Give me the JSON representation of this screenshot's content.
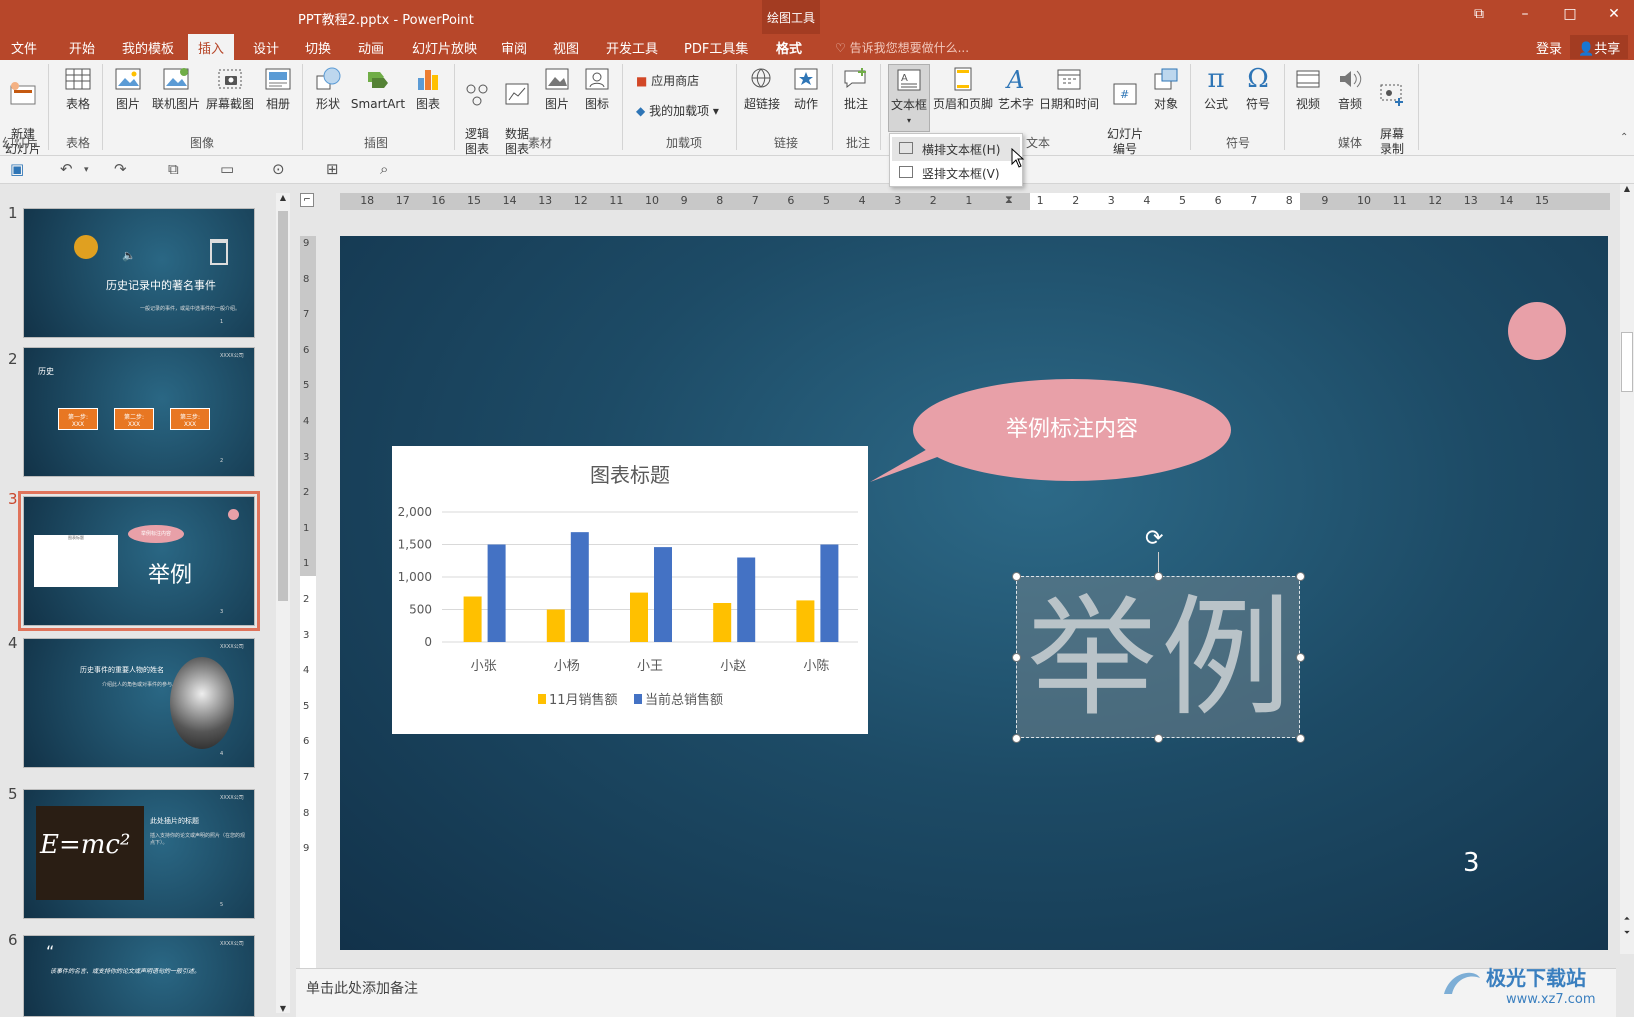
{
  "titlebar": {
    "document_title": "PPT教程2.pptx - PowerPoint",
    "context_tab": "绘图工具"
  },
  "tabs": {
    "items": [
      "文件",
      "开始",
      "我的模板",
      "插入",
      "设计",
      "切换",
      "动画",
      "幻灯片放映",
      "审阅",
      "视图",
      "开发工具",
      "PDF工具集",
      "格式"
    ],
    "active": "插入",
    "tell_me": "告诉我您想要做什么...",
    "login": "登录",
    "share": "共享"
  },
  "ribbon": {
    "buttons": {
      "new_slide": "新建\n幻灯片",
      "table": "表格",
      "picture": "图片",
      "online_picture": "联机图片",
      "screenshot": "屏幕截图",
      "album": "相册",
      "shapes": "形状",
      "smartart": "SmartArt",
      "chart": "图表",
      "logic_chart": "逻辑\n图表",
      "data_chart": "数据\n图表",
      "picture2": "图片",
      "icon": "图标",
      "app_store": "应用商店",
      "my_addins": "我的加载项",
      "hyperlink": "超链接",
      "action": "动作",
      "comment": "批注",
      "textbox": "文本框",
      "header_footer": "页眉和页脚",
      "wordart": "艺术字",
      "datetime": "日期和时间",
      "slide_number": "幻灯片\n编号",
      "object": "对象",
      "equation": "公式",
      "symbol": "符号",
      "video": "视频",
      "audio": "音频",
      "screen_recording": "屏幕\n录制"
    },
    "groups": {
      "slides": "幻灯片",
      "tables": "表格",
      "images": "图像",
      "illustrations": "插图",
      "assets": "素材",
      "addins": "加载项",
      "links": "链接",
      "comments": "批注",
      "text": "文本",
      "symbols": "符号",
      "media": "媒体"
    }
  },
  "textbox_menu": {
    "horizontal": "横排文本框(H)",
    "vertical": "竖排文本框(V)"
  },
  "ruler": {
    "h_left": [
      "18",
      "17",
      "16",
      "15",
      "14",
      "13",
      "12",
      "11",
      "10",
      "9",
      "8",
      "7",
      "6",
      "5",
      "4",
      "3",
      "2",
      "1"
    ],
    "h_right": [
      "1",
      "2",
      "3",
      "4",
      "5",
      "6",
      "7",
      "8",
      "9",
      "10",
      "11",
      "12",
      "13",
      "14",
      "15"
    ],
    "v": [
      "9",
      "8",
      "7",
      "6",
      "5",
      "4",
      "3",
      "2",
      "1",
      "1",
      "2",
      "3",
      "4",
      "5",
      "6",
      "7",
      "8",
      "9"
    ]
  },
  "thumbnails": {
    "numbers": [
      "1",
      "2",
      "3",
      "4",
      "5",
      "6"
    ],
    "slide1_title": "历史记录中的著名事件",
    "slide1_sub": "一般记录的事件，或是中选事件的一般介绍。",
    "slide2_title": "历史",
    "slide2_steps": [
      "第一步:",
      "第二步:",
      "第三步:"
    ],
    "slide2_step_sub": "XXX",
    "slide3_bubble": "举例标注内容",
    "slide3_text": "举例",
    "slide3_chart_title": "图表标题",
    "slide4_title": "历史事件的重要人物的姓名",
    "slide4_sub": "介绍此人的角色或对事件的参与。",
    "slide5_eq": "E=mc²",
    "slide5_title": "此处插片的标题",
    "slide5_sub": "插入支持你的论文或声明的照片（在您的观点下）。",
    "slide6_quote": "该事件的名言、或支持你的论文或声明语句的一般引述。",
    "logo_text": "XXXX公司",
    "page_nums": [
      "1",
      "2",
      "3",
      "4",
      "5"
    ]
  },
  "slide": {
    "bubble_text": "举例标注内容",
    "main_text": "举例",
    "page_number": "3"
  },
  "chart_data": {
    "type": "bar",
    "title": "图表标题",
    "categories": [
      "小张",
      "小杨",
      "小王",
      "小赵",
      "小陈"
    ],
    "series": [
      {
        "name": "11月销售额",
        "values": [
          700,
          500,
          760,
          600,
          640
        ],
        "color": "#FFC000"
      },
      {
        "name": "当前总销售额",
        "values": [
          1500,
          1690,
          1460,
          1300,
          1500
        ],
        "color": "#4472C4"
      }
    ],
    "yticks": [
      "0",
      "500",
      "1,000",
      "1,500",
      "2,000"
    ],
    "ylim": [
      0,
      2000
    ],
    "grid": true,
    "legend_position": "bottom"
  },
  "notes": {
    "placeholder": "单击此处添加备注"
  },
  "watermark": {
    "brand": "极光下载站",
    "url": "www.xz7.com"
  },
  "colors": {
    "accent": "#b7472a",
    "bubble": "#e8a0a8",
    "slide_bg": "#1d4b66"
  }
}
